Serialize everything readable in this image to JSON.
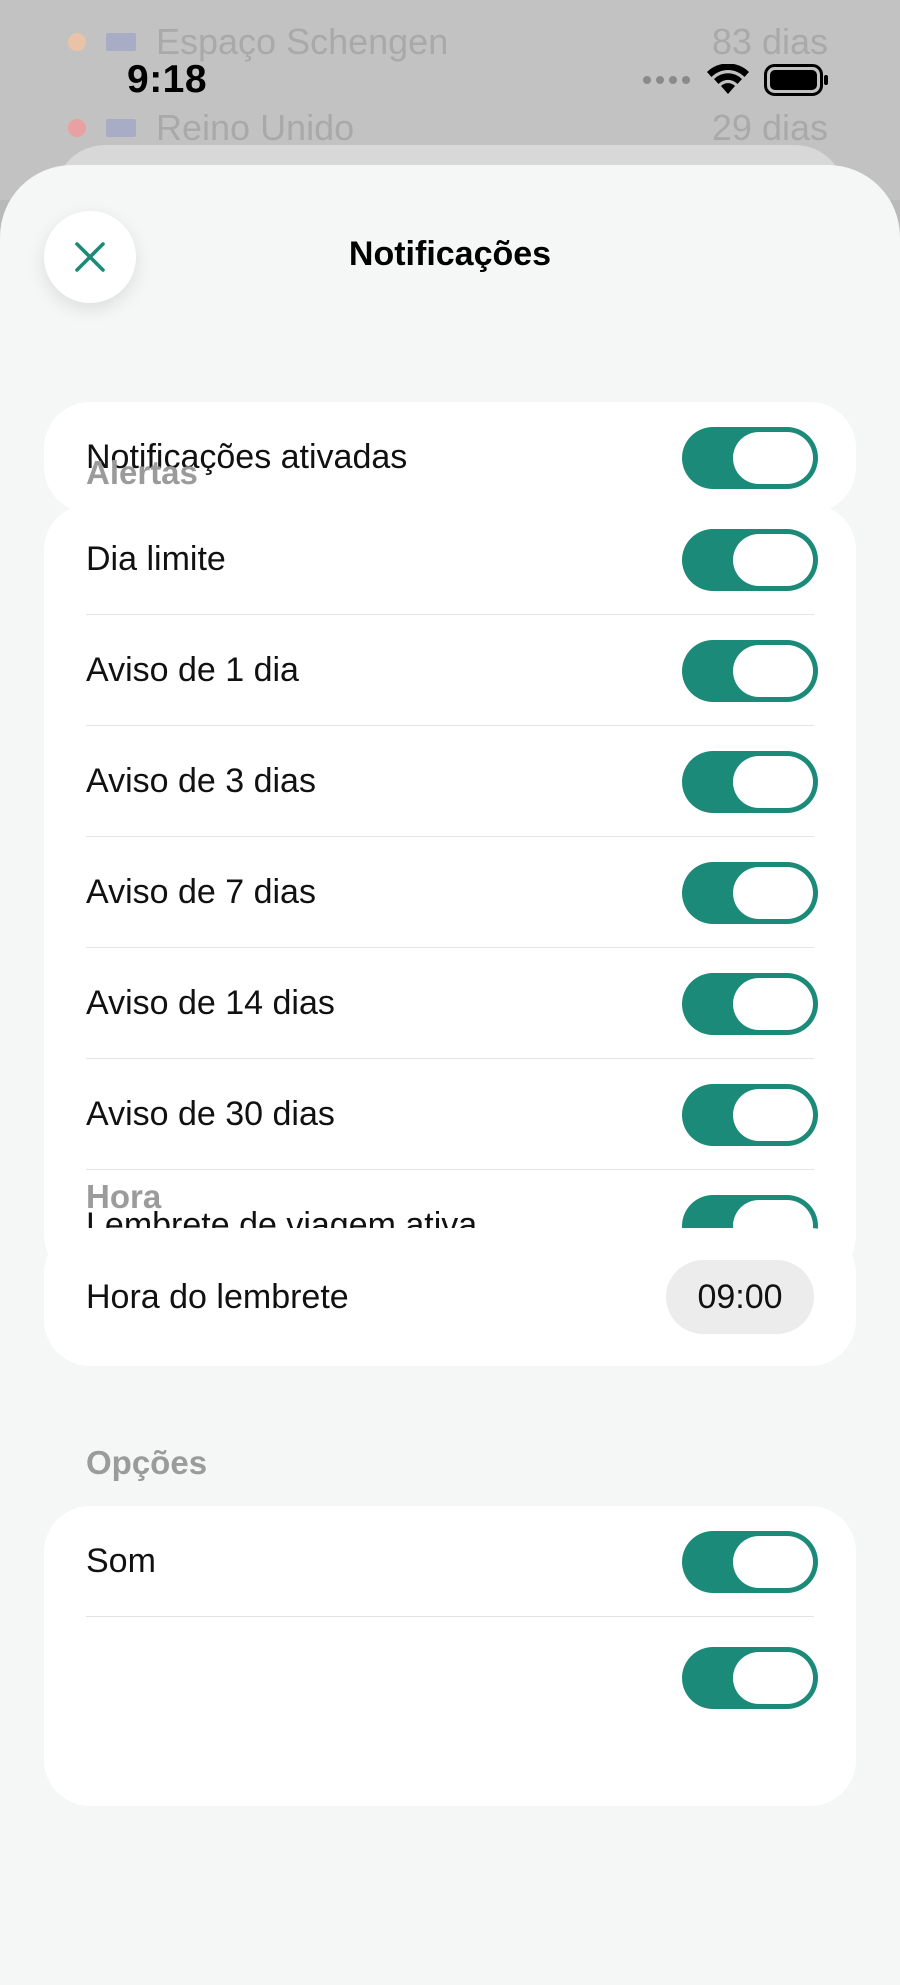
{
  "background": {
    "rows": [
      {
        "label": "Espaço Schengen",
        "value": "83 dias",
        "dot_color": "#f3c8a9"
      },
      {
        "label": "Reino Unido",
        "value": "29 dias",
        "dot_color": "#f0a3a3"
      }
    ]
  },
  "status_bar": {
    "time": "9:18",
    "icons": [
      "signal-dots-icon",
      "wifi-icon",
      "battery-icon"
    ]
  },
  "sheet": {
    "title": "Notificações",
    "close_icon": "close-icon",
    "master": {
      "label": "Notificações ativadas",
      "on": true
    },
    "sections": {
      "alerts": {
        "title": "Alertas",
        "items": [
          {
            "label": "Dia limite",
            "on": true
          },
          {
            "label": "Aviso de 1 dia",
            "on": true
          },
          {
            "label": "Aviso de 3 dias",
            "on": true
          },
          {
            "label": "Aviso de 7 dias",
            "on": true
          },
          {
            "label": "Aviso de 14 dias",
            "on": true
          },
          {
            "label": "Aviso de 30 dias",
            "on": true
          },
          {
            "label": "Lembrete de viagem ativa",
            "on": true
          }
        ]
      },
      "time": {
        "title": "Hora",
        "label": "Hora do lembrete",
        "value": "09:00"
      },
      "options": {
        "title": "Opções",
        "items": [
          {
            "label": "Som",
            "on": true
          }
        ]
      }
    }
  },
  "colors": {
    "accent": "#1b8a78",
    "sheet_bg": "#f5f6f6",
    "card_bg": "#ffffff",
    "section_label": "#9b9b9b"
  }
}
